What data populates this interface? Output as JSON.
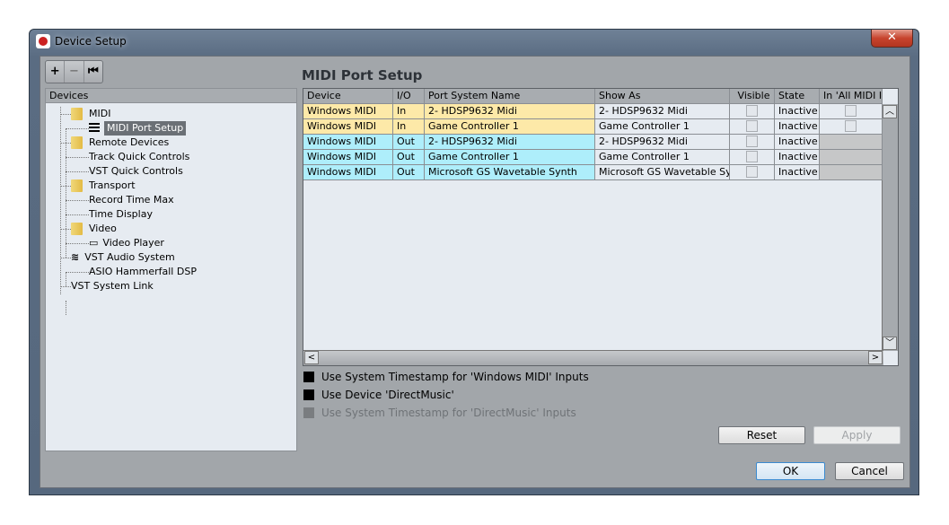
{
  "window": {
    "title": "Device Setup",
    "close_label": "✕"
  },
  "toolbar": {
    "add": "+",
    "remove": "−",
    "reset": "⏮"
  },
  "tree": {
    "header": "Devices",
    "items": [
      {
        "label": "MIDI",
        "icon": "folder-icon"
      },
      {
        "label": "MIDI Port Setup",
        "icon": "midi-port-icon",
        "selected": true
      },
      {
        "label": "Remote Devices",
        "icon": "folder-icon"
      },
      {
        "label": "Track Quick Controls"
      },
      {
        "label": "VST Quick Controls"
      },
      {
        "label": "Transport",
        "icon": "folder-icon"
      },
      {
        "label": "Record Time Max"
      },
      {
        "label": "Time Display"
      },
      {
        "label": "Video",
        "icon": "folder-icon"
      },
      {
        "label": "Video Player",
        "icon": "video-icon"
      },
      {
        "label": "VST Audio System",
        "icon": "audio-wave-icon"
      },
      {
        "label": "ASIO Hammerfall DSP"
      },
      {
        "label": "VST System Link"
      }
    ]
  },
  "panel": {
    "title": "MIDI Port Setup"
  },
  "table": {
    "columns": [
      "Device",
      "I/O",
      "Port System Name",
      "Show As",
      "Visible",
      "State",
      "In 'All MIDI Inputs'"
    ],
    "columns_display": [
      "Device",
      "I/O",
      "Port System Name",
      "Show As",
      "Visible",
      "State",
      "In 'All MIDI I"
    ],
    "rows": [
      [
        "Windows MIDI",
        "In",
        "2- HDSP9632 Midi",
        "2- HDSP9632 Midi",
        "",
        "Inactive",
        ""
      ],
      [
        "Windows MIDI",
        "In",
        "Game Controller 1",
        "Game Controller 1",
        "",
        "Inactive",
        ""
      ],
      [
        "Windows MIDI",
        "Out",
        "2- HDSP9632 Midi",
        "2- HDSP9632 Midi",
        "",
        "Inactive",
        ""
      ],
      [
        "Windows MIDI",
        "Out",
        "Game Controller 1",
        "Game Controller 1",
        "",
        "Inactive",
        ""
      ],
      [
        "Windows MIDI",
        "Out",
        "Microsoft GS Wavetable Synth",
        "Microsoft GS Wavetable Synth",
        "",
        "Inactive",
        ""
      ]
    ],
    "in_color": "#fde9a8",
    "out_color": "#aeeefb"
  },
  "options": [
    {
      "label": "Use System Timestamp for 'Windows MIDI' Inputs",
      "checked": true,
      "enabled": true
    },
    {
      "label": "Use Device 'DirectMusic'",
      "checked": true,
      "enabled": true
    },
    {
      "label": "Use System Timestamp for 'DirectMusic' Inputs",
      "checked": false,
      "enabled": false
    }
  ],
  "buttons": {
    "reset": "Reset",
    "apply": "Apply",
    "ok": "OK",
    "cancel": "Cancel"
  }
}
